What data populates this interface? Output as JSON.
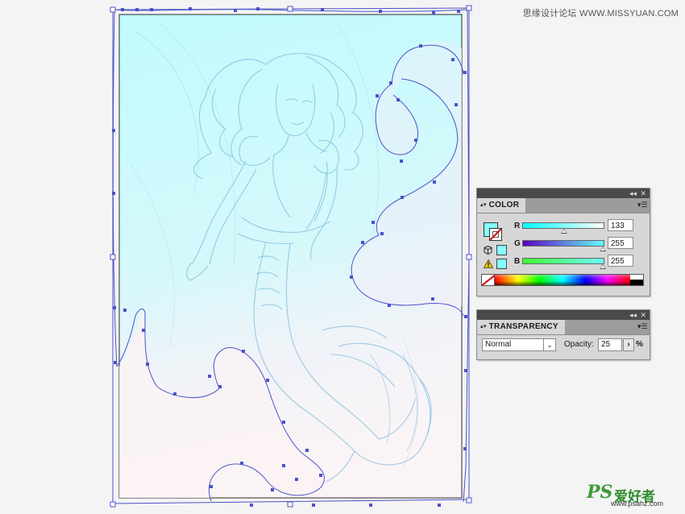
{
  "watermark_top": "思缘设计论坛 WWW.MISSYUAN.COM",
  "watermark_bottom": {
    "logo": "PS",
    "cn": "爱好者",
    "url": "www.psahz.com"
  },
  "colors": {
    "fill": "#85ffff",
    "artboard_top": "#c3fbfc",
    "artboard_bottom": "#fbf3f5",
    "selection": "#4a52c8",
    "sketch": "#6fb7d8"
  },
  "color_panel": {
    "title": "COLOR",
    "channels": [
      {
        "label": "R",
        "value": "133",
        "fraction": 0.52
      },
      {
        "label": "G",
        "value": "255",
        "fraction": 1.0
      },
      {
        "label": "B",
        "value": "255",
        "fraction": 1.0
      }
    ]
  },
  "transparency_panel": {
    "title": "TRANSPARENCY",
    "blend_mode": "Normal",
    "opacity_label": "Opacity:",
    "opacity_value": "25",
    "opacity_unit": "%"
  },
  "icons": {
    "fill_stroke": "fill-stroke-swatch",
    "out_of_web": "cube-icon",
    "out_of_gamut": "warning-icon",
    "panel_menu": "menu-icon",
    "collapse": "double-arrow-icon",
    "close": "close-icon"
  }
}
